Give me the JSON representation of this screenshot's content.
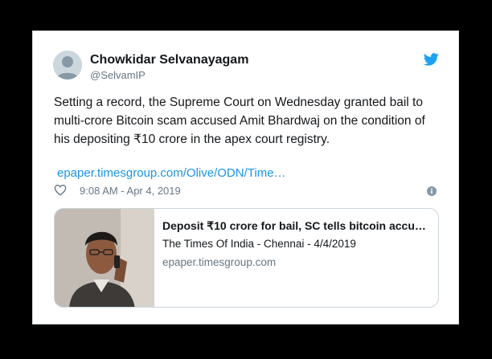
{
  "tweet": {
    "author_name": "Chowkidar Selvanayagam",
    "author_handle": "@SelvamIP",
    "text": "Setting a record, the Supreme Court on Wednesday granted bail to multi-crore Bitcoin scam accused Amit Bhardwaj on the condition of his depositing ₹10 crore in the apex court registry.",
    "link_text": "epaper.timesgroup.com/Olive/ODN/Time…",
    "timestamp": "9:08 AM - Apr 4, 2019"
  },
  "link_card": {
    "title": "Deposit ₹10 crore for bail, SC tells bitcoin accu…",
    "source": "The Times Of India - Chennai - 4/4/2019",
    "domain": "epaper.timesgroup.com"
  },
  "icons": {
    "brand": "twitter-bird-icon",
    "like": "heart-icon",
    "info": "info-icon"
  },
  "colors": {
    "twitter_blue": "#1da1f2",
    "link_blue": "#1b95e0",
    "secondary_text": "#657786",
    "primary_text": "#14171a",
    "border": "#ccd6dd"
  }
}
